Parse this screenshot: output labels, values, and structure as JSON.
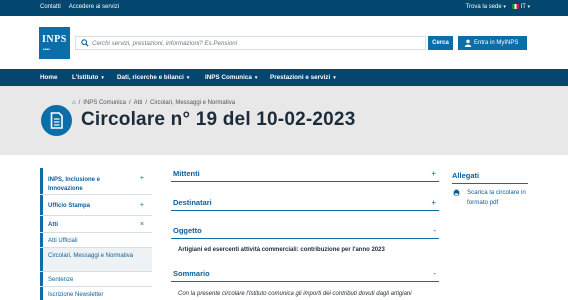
{
  "topbar": {
    "contatti": "Contatti",
    "accedere": "Accedere ai servizi",
    "trova_sede": "Trova la sede",
    "lang": "IT"
  },
  "header": {
    "logo_text": "INPS",
    "search_placeholder": "Cerchi servizi, prestazioni, informazioni? Es.Pensioni",
    "search_button": "Cerca",
    "myinps_button": "Entra in MyINPS"
  },
  "nav": {
    "items": [
      {
        "label": "Home"
      },
      {
        "label": "L'Istituto"
      },
      {
        "label": "Dati, ricerche e bilanci"
      },
      {
        "label": "INPS Comunica"
      },
      {
        "label": "Prestazioni e servizi"
      }
    ]
  },
  "breadcrumb": {
    "items": [
      "INPS Comunica",
      "Atti",
      "Circolari, Messaggi e Normativa"
    ]
  },
  "page": {
    "title": "Circolare n° 19 del 10-02-2023"
  },
  "sidebar": {
    "items": [
      {
        "label": "INPS, Inclusione e Innovazione",
        "toggle": "+"
      },
      {
        "label": "Ufficio Stampa",
        "toggle": "+"
      },
      {
        "label": "Atti",
        "toggle": "×"
      },
      {
        "label": "Atti Ufficiali"
      },
      {
        "label": "Circolari, Messaggi e Normativa"
      },
      {
        "label": "Sentenze"
      },
      {
        "label": "Iscrizione Newsletter"
      }
    ]
  },
  "sections": {
    "mittenti": {
      "title": "Mittenti",
      "toggle": "+"
    },
    "destinatari": {
      "title": "Destinatari",
      "toggle": "+"
    },
    "oggetto": {
      "title": "Oggetto",
      "toggle": "-",
      "text": "Artigiani ed esercenti attività commerciali: contribuzione per l'anno 2023"
    },
    "sommario": {
      "title": "Sommario",
      "toggle": "-",
      "text": "Con la presente circolare l'Istituto comunica gli importi dei contributi dovuti dagli artigiani"
    }
  },
  "allegati": {
    "title": "Allegati",
    "link": "Scarica la circolare in formato pdf"
  },
  "colors": {
    "dark_blue": "#03466e",
    "brand_blue": "#0b6ea9",
    "band_grey": "#e8e8e8"
  }
}
